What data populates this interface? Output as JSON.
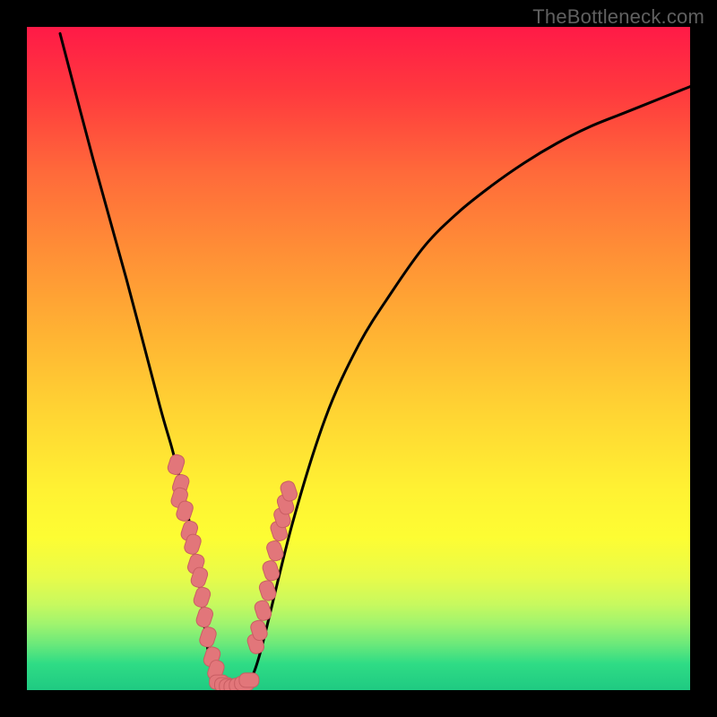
{
  "watermark": "TheBottleneck.com",
  "colors": {
    "frame": "#000000",
    "curve": "#000000",
    "marker_fill": "#e2767a",
    "marker_stroke": "#c95e63"
  },
  "chart_data": {
    "type": "line",
    "title": "",
    "xlabel": "",
    "ylabel": "",
    "xlim": [
      0,
      100
    ],
    "ylim": [
      0,
      100
    ],
    "grid": false,
    "legend": false,
    "x": [
      5,
      10,
      15,
      20,
      22,
      24,
      25,
      26,
      27,
      28,
      30,
      31.5,
      33,
      35,
      40,
      45,
      50,
      55,
      60,
      65,
      70,
      75,
      80,
      85,
      90,
      95,
      100
    ],
    "values": [
      99,
      80,
      62,
      43,
      36,
      28,
      22,
      16,
      8,
      3,
      1,
      0.5,
      1,
      5,
      25,
      41,
      52,
      60,
      67,
      72,
      76,
      79.5,
      82.5,
      85,
      87,
      89,
      91
    ],
    "markers_left": {
      "x": [
        22.5,
        23.2,
        23.0,
        23.8,
        24.5,
        25.0,
        25.5,
        26.0,
        26.4,
        26.8,
        27.3,
        27.9,
        28.5
      ],
      "y": [
        34,
        31,
        29,
        27,
        24,
        22,
        19,
        17,
        14,
        11,
        8,
        5,
        3
      ]
    },
    "markers_right": {
      "x": [
        34.5,
        35.0,
        35.6,
        36.3,
        36.8,
        37.4,
        38.0,
        38.5,
        39.0,
        39.5
      ],
      "y": [
        7,
        9,
        12,
        15,
        18,
        21,
        24,
        26,
        28,
        30
      ]
    },
    "markers_bottom": {
      "x": [
        29.0,
        29.8,
        30.5,
        31.2,
        32.0,
        32.8,
        33.5
      ],
      "y": [
        1.2,
        0.8,
        0.6,
        0.5,
        0.7,
        1.0,
        1.5
      ]
    }
  }
}
